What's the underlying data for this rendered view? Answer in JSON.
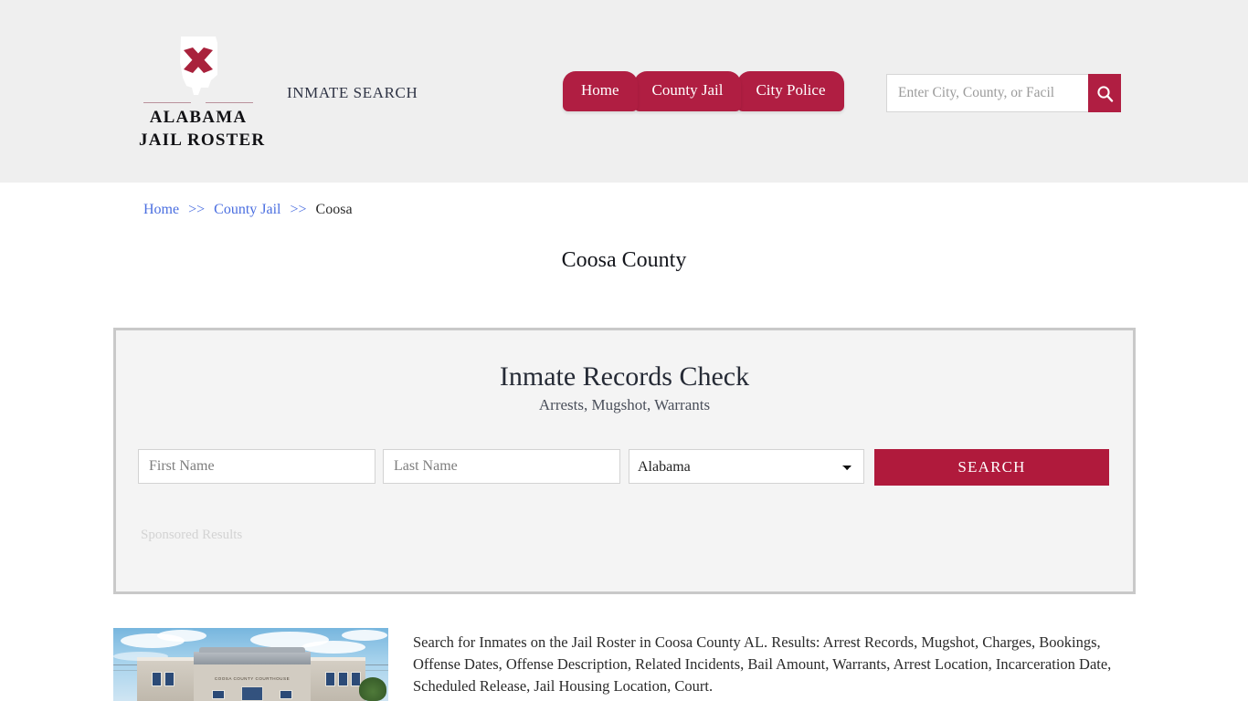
{
  "header": {
    "logo": {
      "icon": "alabama-state-flag-icon",
      "line1": "ALABAMA",
      "line2": "JAIL ROSTER",
      "dots": "•••"
    },
    "tagline": "INMATE SEARCH",
    "nav": [
      {
        "label": "Home"
      },
      {
        "label": "County Jail"
      },
      {
        "label": "City Police"
      }
    ],
    "search": {
      "placeholder": "Enter City, County, or Facil",
      "value": "",
      "button_icon": "search-icon"
    },
    "background_color": "#efefef"
  },
  "breadcrumb": {
    "items": [
      {
        "label": "Home",
        "link": true
      },
      {
        "label": "County Jail",
        "link": true
      },
      {
        "label": "Coosa",
        "link": false
      }
    ],
    "separator": ">>"
  },
  "page": {
    "title": "Coosa County"
  },
  "search_card": {
    "title": "Inmate Records Check",
    "subtitle": "Arrests, Mugshot, Warrants",
    "first_name_placeholder": "First Name",
    "first_name_value": "",
    "last_name_placeholder": "Last Name",
    "last_name_value": "",
    "state_selected": "Alabama",
    "state_options": [
      "Alabama"
    ],
    "search_button": "SEARCH",
    "sponsored_label": "Sponsored Results"
  },
  "content": {
    "image_caption": "COOSA COUNTY COURTHOUSE",
    "paragraph": "Search for Inmates on the Jail Roster in Coosa County AL. Results: Arrest Records, Mugshot, Charges, Bookings, Offense Dates, Offense Description, Related Incidents, Bail Amount, Warrants, Arrest Location, Incarceration Date, Scheduled Release, Jail Housing Location, Court."
  },
  "colors": {
    "brand_crimson": "#b01e42",
    "button_crimson": "#b01a3c",
    "link_blue": "#4a6ee0",
    "header_gray": "#efefef",
    "card_gray": "#f4f4f4",
    "card_border": "#c9c9c9"
  }
}
